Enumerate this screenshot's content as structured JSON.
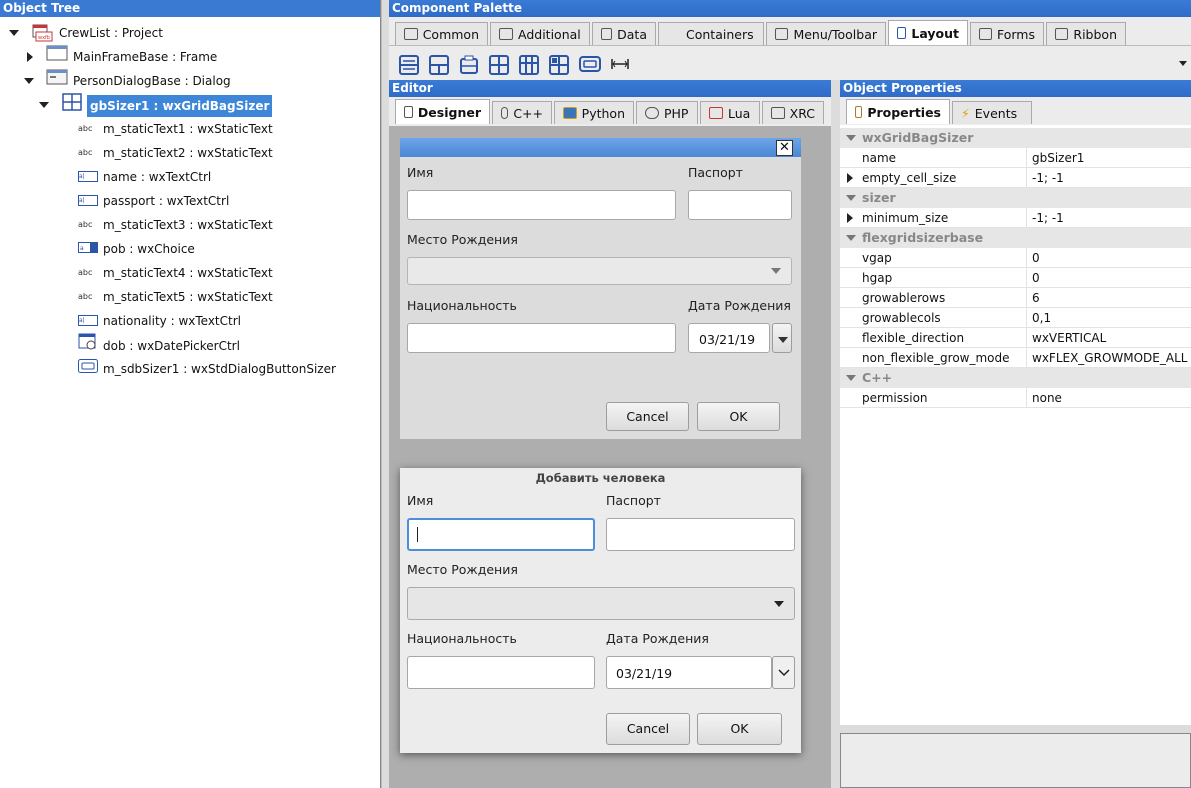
{
  "object_tree": {
    "title": "Object Tree",
    "nodes": [
      {
        "label": "CrewList : Project"
      },
      {
        "label": "MainFrameBase : Frame"
      },
      {
        "label": "PersonDialogBase : Dialog"
      },
      {
        "label": "gbSizer1 : wxGridBagSizer"
      },
      {
        "label": "m_staticText1 : wxStaticText"
      },
      {
        "label": "m_staticText2 : wxStaticText"
      },
      {
        "label": "name : wxTextCtrl"
      },
      {
        "label": "passport : wxTextCtrl"
      },
      {
        "label": "m_staticText3 : wxStaticText"
      },
      {
        "label": "pob : wxChoice"
      },
      {
        "label": "m_staticText4 : wxStaticText"
      },
      {
        "label": "m_staticText5 : wxStaticText"
      },
      {
        "label": "nationality : wxTextCtrl"
      },
      {
        "label": "dob : wxDatePickerCtrl"
      },
      {
        "label": "m_sdbSizer1 : wxStdDialogButtonSizer"
      }
    ]
  },
  "palette": {
    "title": "Component Palette",
    "tabs": [
      "Common",
      "Additional",
      "Data",
      "Containers",
      "Menu/Toolbar",
      "Layout",
      "Forms",
      "Ribbon"
    ],
    "active_tab": "Layout"
  },
  "editor": {
    "title": "Editor",
    "tabs": [
      "Designer",
      "C++",
      "Python",
      "PHP",
      "Lua",
      "XRC"
    ],
    "active_tab": "Designer"
  },
  "design_dialog": {
    "name_label": "Имя",
    "passport_label": "Паспорт",
    "pob_label": "Место Рождения",
    "nationality_label": "Национальность",
    "dob_label": "Дата Рождения",
    "dob_value": "03/21/19",
    "cancel": "Cancel",
    "ok": "OK"
  },
  "preview_dialog": {
    "title": "Добавить человека",
    "name_label": "Имя",
    "passport_label": "Паспорт",
    "pob_label": "Место Рождения",
    "nationality_label": "Национальность",
    "dob_label": "Дата Рождения",
    "dob_value": "03/21/19",
    "cancel": "Cancel",
    "ok": "OK"
  },
  "object_properties": {
    "title": "Object Properties",
    "tabs": [
      "Properties",
      "Events"
    ],
    "active_tab": "Properties",
    "rows": [
      {
        "type": "cat",
        "name": "wxGridBagSizer"
      },
      {
        "type": "prop",
        "name": "name",
        "value": "gbSizer1"
      },
      {
        "type": "prop",
        "name": "empty_cell_size",
        "value": "-1; -1",
        "expandable": true
      },
      {
        "type": "cat",
        "name": "sizer"
      },
      {
        "type": "prop",
        "name": "minimum_size",
        "value": "-1; -1",
        "expandable": true
      },
      {
        "type": "cat",
        "name": "flexgridsizerbase"
      },
      {
        "type": "prop",
        "name": "vgap",
        "value": "0"
      },
      {
        "type": "prop",
        "name": "hgap",
        "value": "0"
      },
      {
        "type": "prop",
        "name": "growablerows",
        "value": "6"
      },
      {
        "type": "prop",
        "name": "growablecols",
        "value": "0,1"
      },
      {
        "type": "prop",
        "name": "flexible_direction",
        "value": "wxVERTICAL"
      },
      {
        "type": "prop",
        "name": "non_flexible_grow_mode",
        "value": "wxFLEX_GROWMODE_ALL"
      },
      {
        "type": "cat",
        "name": "C++"
      },
      {
        "type": "prop",
        "name": "permission",
        "value": "none"
      }
    ]
  }
}
